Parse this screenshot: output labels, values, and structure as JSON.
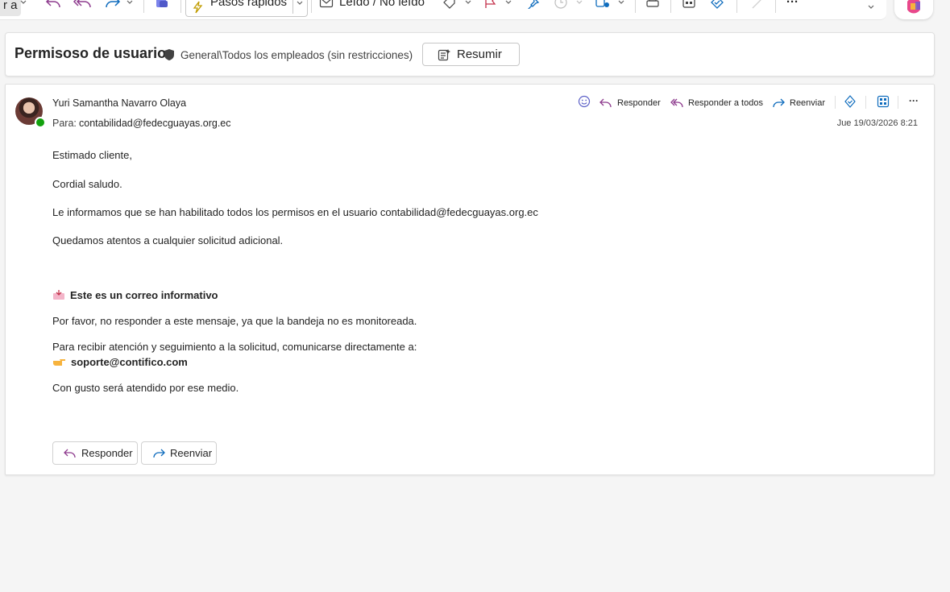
{
  "toolbar": {
    "partial_left_label": "r a",
    "quick_steps_label": "Pasos rápidos",
    "read_unread_label": "Leído / No leído",
    "more_label": "···"
  },
  "subject_bar": {
    "subject": "Permisoso de usuario",
    "sensitivity_label": "General\\Todos los empleados (sin restricciones)",
    "summarize_label": "Resumir"
  },
  "message": {
    "sender_name": "Yuri Samantha Navarro Olaya",
    "to_label": "Para:",
    "to_address": "contabilidad@fedecguayas.org.ec",
    "date": "Jue 19/03/2026 8:21",
    "actions": {
      "reply": "Responder",
      "reply_all": "Responder a todos",
      "forward": "Reenviar",
      "more": "···"
    },
    "body": {
      "greeting": "Estimado cliente,",
      "salutation": "Cordial saludo.",
      "line1": "Le informamos que se han habilitado todos los permisos en el usuario contabilidad@fedecguayas.org.ec",
      "line2": "Quedamos atentos a cualquier solicitud adicional.",
      "info_heading": "Este es un correo informativo",
      "info_line1": "Por favor, no responder a este mensaje, ya que la bandeja no es monitoreada.",
      "info_line2": "Para recibir atención y seguimiento a la solicitud, comunicarse directamente a:",
      "support_email": "soporte@contifico.com",
      "closing": "Con gusto será atendido por ese medio."
    },
    "footer": {
      "reply_label": "Responder",
      "forward_label": "Reenviar"
    }
  },
  "colors": {
    "reply_icon": "#8e3b8e",
    "forward_icon": "#0f6cbd",
    "flag": "#c4314b",
    "accent_blue": "#0f6cbd"
  }
}
